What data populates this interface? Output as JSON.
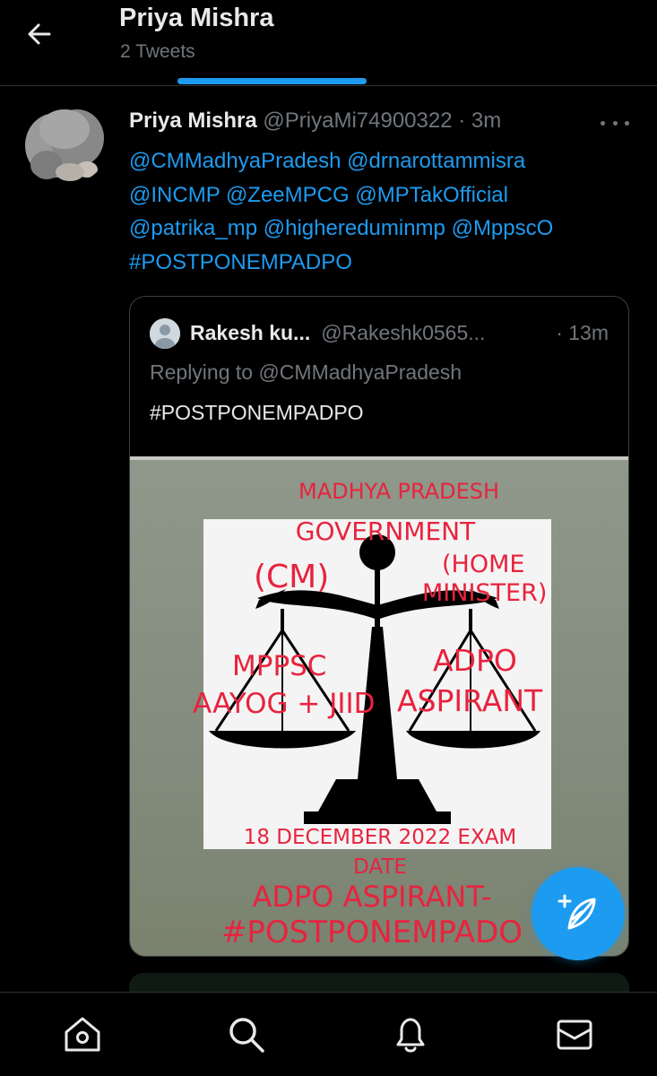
{
  "header": {
    "title": "Priya Mishra",
    "subtitle": "2 Tweets"
  },
  "tweet": {
    "author_name": "Priya Mishra",
    "author_handle": "@PriyaMi74900322",
    "separator": "·",
    "time": "3m",
    "lines": [
      [
        "@CMMadhyaPradesh",
        "@drnarottammisra"
      ],
      [
        "@INCMP",
        "@ZeeMPCG",
        "@MPTakOfficial"
      ],
      [
        "@patrika_mp",
        "@highereduminmp",
        "@MppscO"
      ],
      [
        "#POSTPONEMPADPO"
      ]
    ]
  },
  "quoted": {
    "author_name": "Rakesh ku...",
    "author_handle": "@Rakeshk0565...",
    "time": "· 13m",
    "replying_to": "Replying to @CMMadhyaPradesh",
    "text": "#POSTPONEMPADPO",
    "image_text": {
      "line1": "MADHYA PRADESH",
      "line2": "GOVERNMENT",
      "cm": "(CM)",
      "home1": "(HOME",
      "home2": "MINISTER)",
      "left1": "MPPSC",
      "left2": "AAYOG + JIID",
      "right1": "ADPO",
      "right2": "ASPIRANT",
      "date1": "18 DECEMBER 2022 EXAM",
      "date2": "DATE",
      "bottom1": "ADPO ASPIRANT-",
      "bottom2": "#POSTPONEMPADO"
    }
  },
  "colors": {
    "accent": "#1d9bf0",
    "background": "#000000",
    "muted": "#71767b",
    "poster_text": "#e8233e"
  },
  "icons": {
    "back": "arrow-left-icon",
    "more": "more-horizontal-icon",
    "compose": "compose-feather-icon",
    "nav": [
      "home-icon",
      "search-icon",
      "notifications-bell-icon",
      "messages-envelope-icon"
    ]
  }
}
